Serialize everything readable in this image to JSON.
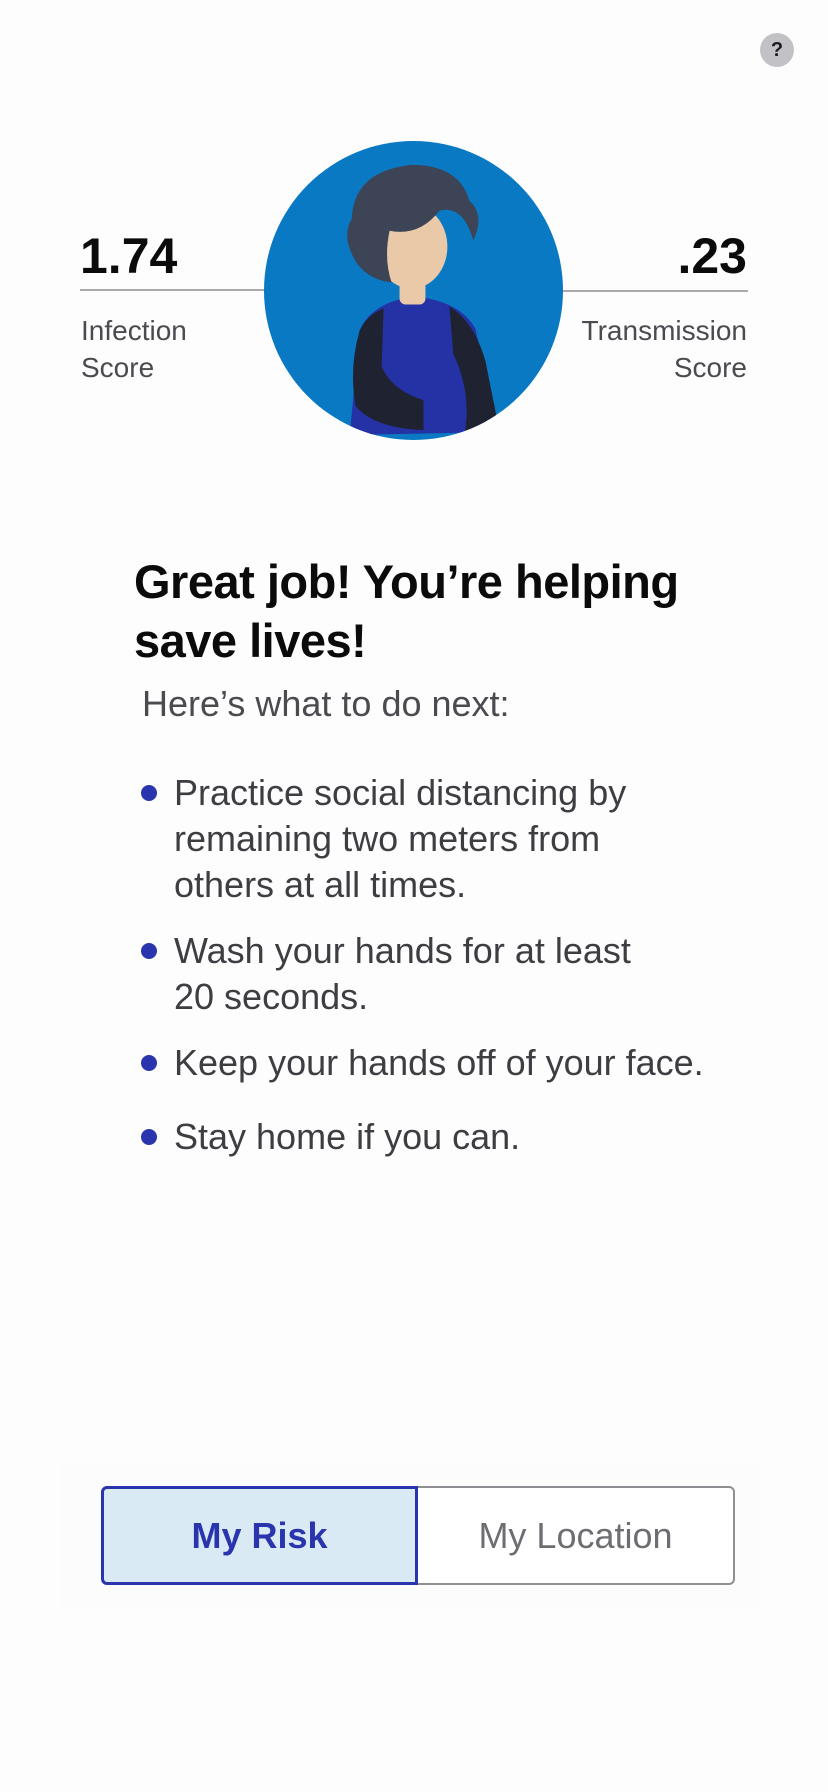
{
  "header": {
    "help_label": "?"
  },
  "scores": {
    "infection": {
      "value": "1.74",
      "label_line1": "Infection",
      "label_line2": "Score"
    },
    "transmission": {
      "value": ".23",
      "label_line1": "Transmission",
      "label_line2": "Score"
    }
  },
  "avatar": {
    "icon": "person-avatar-icon",
    "background_color": "#0a79c4"
  },
  "message": {
    "headline_line1": "Great job! You’re helping",
    "headline_line2": "save lives!",
    "subhead": "Here’s what to do next:"
  },
  "tips": [
    {
      "line1": "Practice social distancing by",
      "line2": "remaining two meters from",
      "line3": "others at all times."
    },
    {
      "line1": "Wash your hands for at least",
      "line2": "20 seconds."
    },
    {
      "line1": "Keep your hands off of your face."
    },
    {
      "line1": "Stay home if you can."
    }
  ],
  "tabs": [
    {
      "label": "My Risk",
      "selected": true
    },
    {
      "label": "My Location",
      "selected": false
    }
  ],
  "colors": {
    "accent": "#2a35ad",
    "active_tab_bg": "#d9eaf5",
    "avatar_bg": "#0a79c4"
  }
}
